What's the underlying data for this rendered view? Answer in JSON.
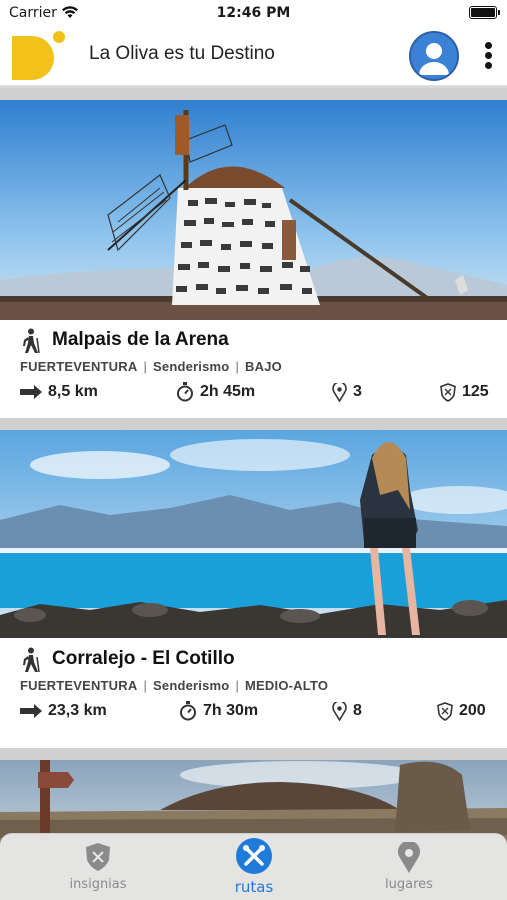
{
  "status": {
    "carrier": "Carrier",
    "time": "12:46 PM"
  },
  "header": {
    "title": "La Oliva es tu Destino",
    "logo_icon": "logo-d-icon",
    "avatar_icon": "user-avatar-icon",
    "menu_icon": "more-vertical-icon"
  },
  "colors": {
    "accent": "#1f7ad8",
    "logo": "#f2c21b",
    "avatar": "#3b82d6"
  },
  "routes": [
    {
      "title": "Malpais de la Arena",
      "region": "FUERTEVENTURA",
      "type": "Senderismo",
      "difficulty": "BAJO",
      "distance": "8,5 km",
      "duration": "2h 45m",
      "points": "3",
      "badge_points": "125",
      "photo": "windmill"
    },
    {
      "title": "Corralejo - El Cotillo",
      "region": "FUERTEVENTURA",
      "type": "Senderismo",
      "difficulty": "MEDIO-ALTO",
      "distance": "23,3 km",
      "duration": "7h 30m",
      "points": "8",
      "badge_points": "200",
      "photo": "coast"
    },
    {
      "photo": "volcano"
    }
  ],
  "tabs": [
    {
      "label": "insignias",
      "icon": "shield-icon",
      "active": false
    },
    {
      "label": "rutas",
      "icon": "routes-icon",
      "active": true
    },
    {
      "label": "lugares",
      "icon": "location-pin-icon",
      "active": false
    }
  ]
}
